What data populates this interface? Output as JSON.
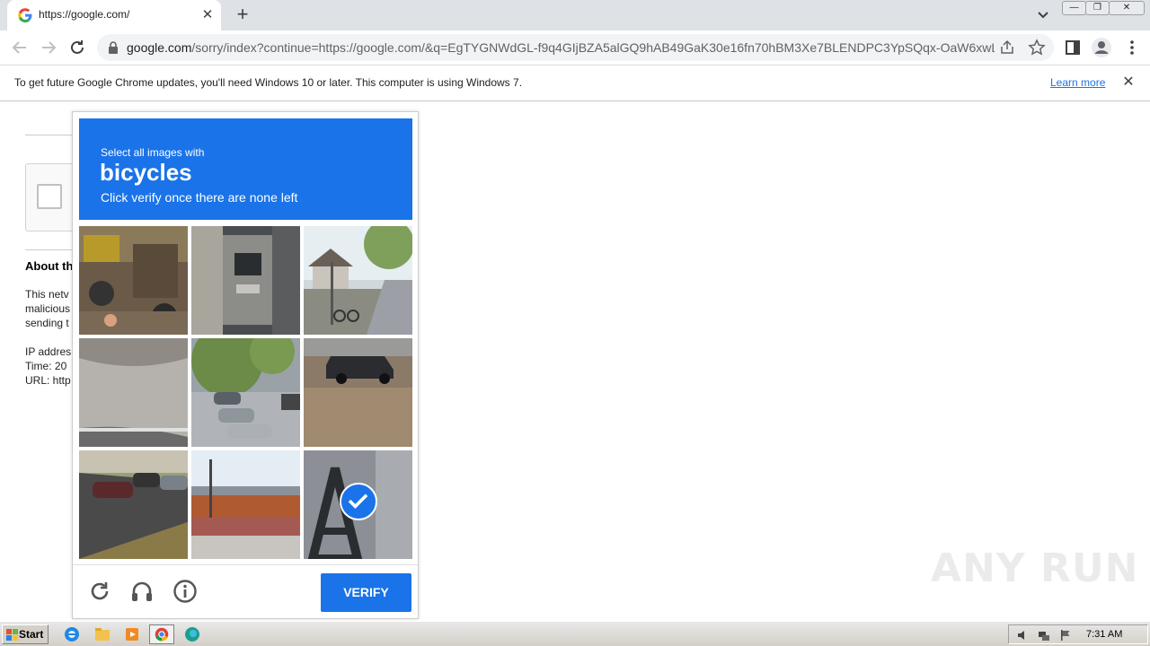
{
  "browser": {
    "tab": {
      "title": "https://google.com/",
      "favicon": "google-g-icon"
    },
    "address": {
      "host": "google.com",
      "path": "/sorry/index?continue=https://google.com/&q=EgTYGNWdGL-f9q4GIjBZA5alGQ9hAB49GaK30e16fn70hBM3Xe7BLENDPC3YpSQqx-OaW6xwL..."
    },
    "infobar": {
      "message": "To get future Google Chrome updates, you'll need Windows 10 or later. This computer is using Windows 7.",
      "link": "Learn more"
    }
  },
  "page": {
    "about_heading": "About th",
    "paragraph": [
      "This netv",
      "malicious",
      "sending t"
    ],
    "details": [
      "IP addres",
      "Time: 20",
      "URL: http"
    ]
  },
  "captcha": {
    "instruction": "Select all images with",
    "object": "bicycles",
    "hint": "Click verify once there are none left",
    "tiles": [
      {
        "scene": "street-bikes",
        "selected": false
      },
      {
        "scene": "atm-machine",
        "selected": false
      },
      {
        "scene": "street-trees-bicycle",
        "selected": false
      },
      {
        "scene": "road-curve",
        "selected": false
      },
      {
        "scene": "parking-lot-cars",
        "selected": false
      },
      {
        "scene": "car-on-pavement",
        "selected": false
      },
      {
        "scene": "highway-cars",
        "selected": false
      },
      {
        "scene": "train-platform",
        "selected": false
      },
      {
        "scene": "graffiti-wall",
        "selected": true
      }
    ],
    "verify_label": "VERIFY",
    "colors": {
      "accent": "#1a73e8"
    }
  },
  "watermark": "ANY RUN",
  "taskbar": {
    "start_label": "Start",
    "clock": "7:31 AM",
    "apps": [
      "internet-explorer-icon",
      "file-explorer-icon",
      "media-player-icon",
      "chrome-icon",
      "edge-icon"
    ]
  }
}
